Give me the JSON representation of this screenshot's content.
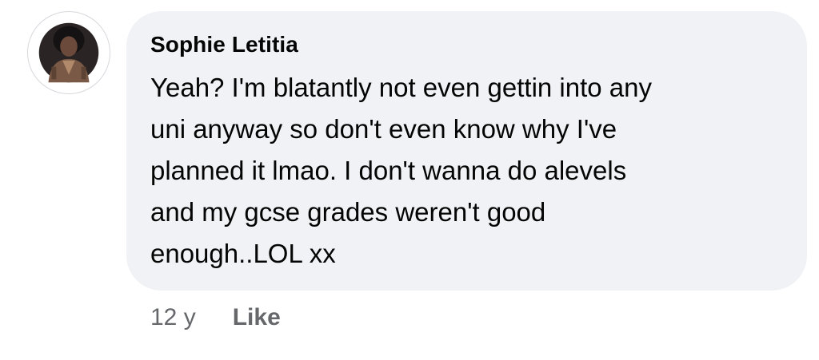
{
  "comment": {
    "author": "Sophie Letitia",
    "text": "Yeah? I'm blatantly not even gettin into any\nuni anyway so don't even know why I've\nplanned it lmao. I don't wanna do alevels\nand my gcse grades weren't good\nenough..LOL xx",
    "timestamp": "12 y",
    "like_label": "Like",
    "avatar_icon": "profile-photo-icon"
  }
}
